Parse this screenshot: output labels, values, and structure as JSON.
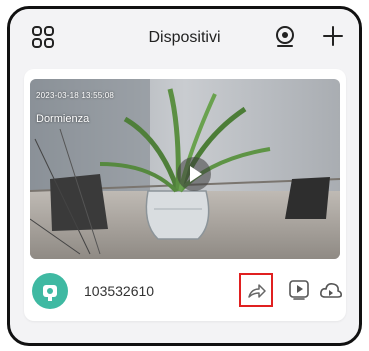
{
  "header": {
    "title": "Dispositivi",
    "left_icon": "grid-menu-icon",
    "right_icons": [
      "camera-add-icon",
      "plus-icon"
    ]
  },
  "device_card": {
    "timestamp": "2023-03-18 13:55:08",
    "status_label": "Dormienza",
    "device_id": "103532610",
    "avatar_icon": "camera-avatar-icon",
    "actions": [
      "share-icon",
      "playback-icon",
      "cloud-icon"
    ],
    "play_icon": "play-icon"
  },
  "colors": {
    "accent_teal": "#3fb9a2",
    "highlight_red": "#e02020",
    "background": "#f3f3f5"
  }
}
